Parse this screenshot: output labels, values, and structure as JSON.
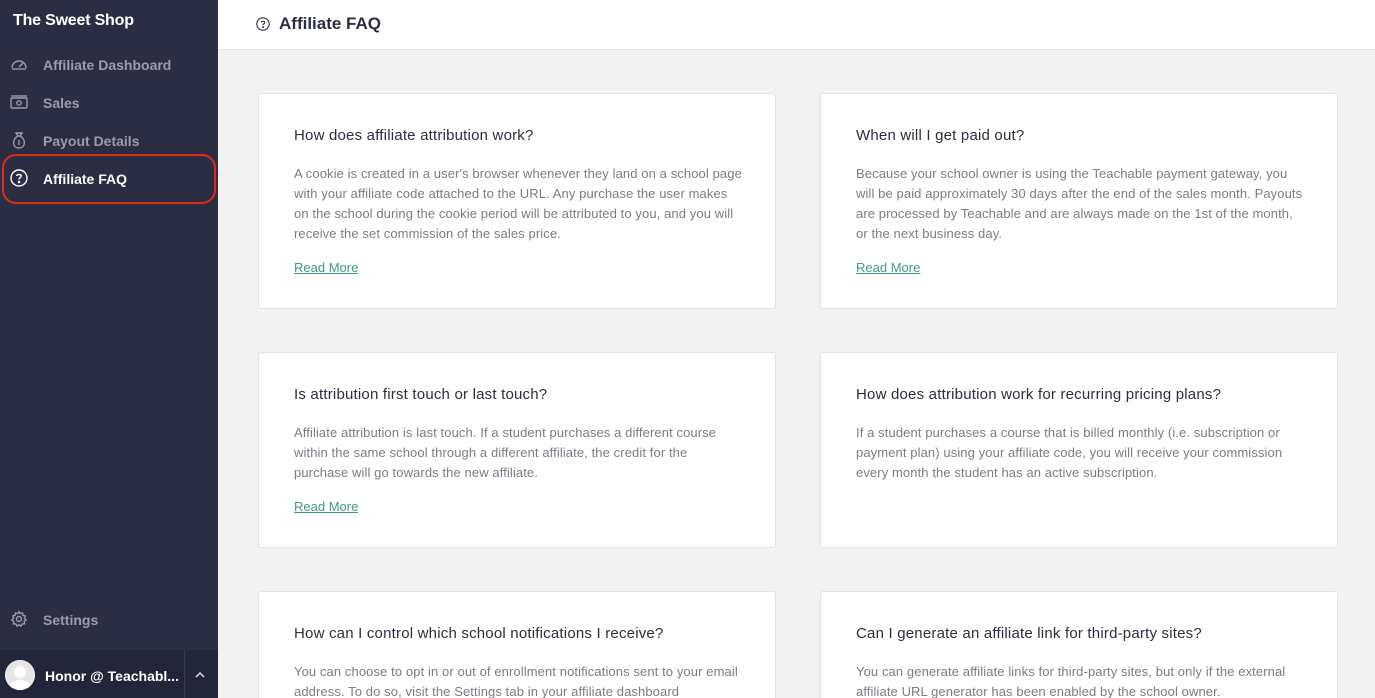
{
  "sidebar": {
    "brand": "The Sweet Shop",
    "items": [
      {
        "label": "Affiliate Dashboard",
        "icon": "speedometer-icon"
      },
      {
        "label": "Sales",
        "icon": "cash-icon"
      },
      {
        "label": "Payout Details",
        "icon": "money-bag-icon"
      },
      {
        "label": "Affiliate FAQ",
        "icon": "question-circle-icon",
        "active": true
      }
    ],
    "settings_label": "Settings",
    "user_name": "Honor @ Teachabl..."
  },
  "header": {
    "title": "Affiliate FAQ"
  },
  "faq": [
    {
      "title": "How does affiliate attribution work?",
      "body": "A cookie is created in a user's browser whenever they land on a school page with your affiliate code attached to the URL. Any purchase the user makes on the school during the cookie period will be attributed to you, and you will receive the set commission of the sales price.",
      "link": "Read More"
    },
    {
      "title": "When will I get paid out?",
      "body": "Because your school owner is using the Teachable payment gateway, you will be paid approximately 30 days after the end of the sales month. Payouts are processed by Teachable and are always made on the 1st of the month, or the next business day.",
      "link": "Read More"
    },
    {
      "title": "Is attribution first touch or last touch?",
      "body": "Affiliate attribution is last touch. If a student purchases a different course within the same school through a different affiliate, the credit for the purchase will go towards the new affiliate.",
      "link": "Read More"
    },
    {
      "title": "How does attribution work for recurring pricing plans?",
      "body": "If a student purchases a course that is billed monthly (i.e. subscription or payment plan) using your affiliate code, you will receive your commission every month the student has an active subscription."
    },
    {
      "title": "How can I control which school notifications I receive?",
      "body": "You can choose to opt in or out of enrollment notifications sent to your email address. To do so, visit the Settings tab in your affiliate dashboard"
    },
    {
      "title": "Can I generate an affiliate link for third-party sites?",
      "body": "You can generate affiliate links for third-party sites, but only if the external affiliate URL generator has been enabled by the school owner."
    }
  ],
  "colors": {
    "sidebar_bg": "#2b2d42",
    "accent_link": "#3e9a84",
    "highlight": "#e02a1a"
  }
}
